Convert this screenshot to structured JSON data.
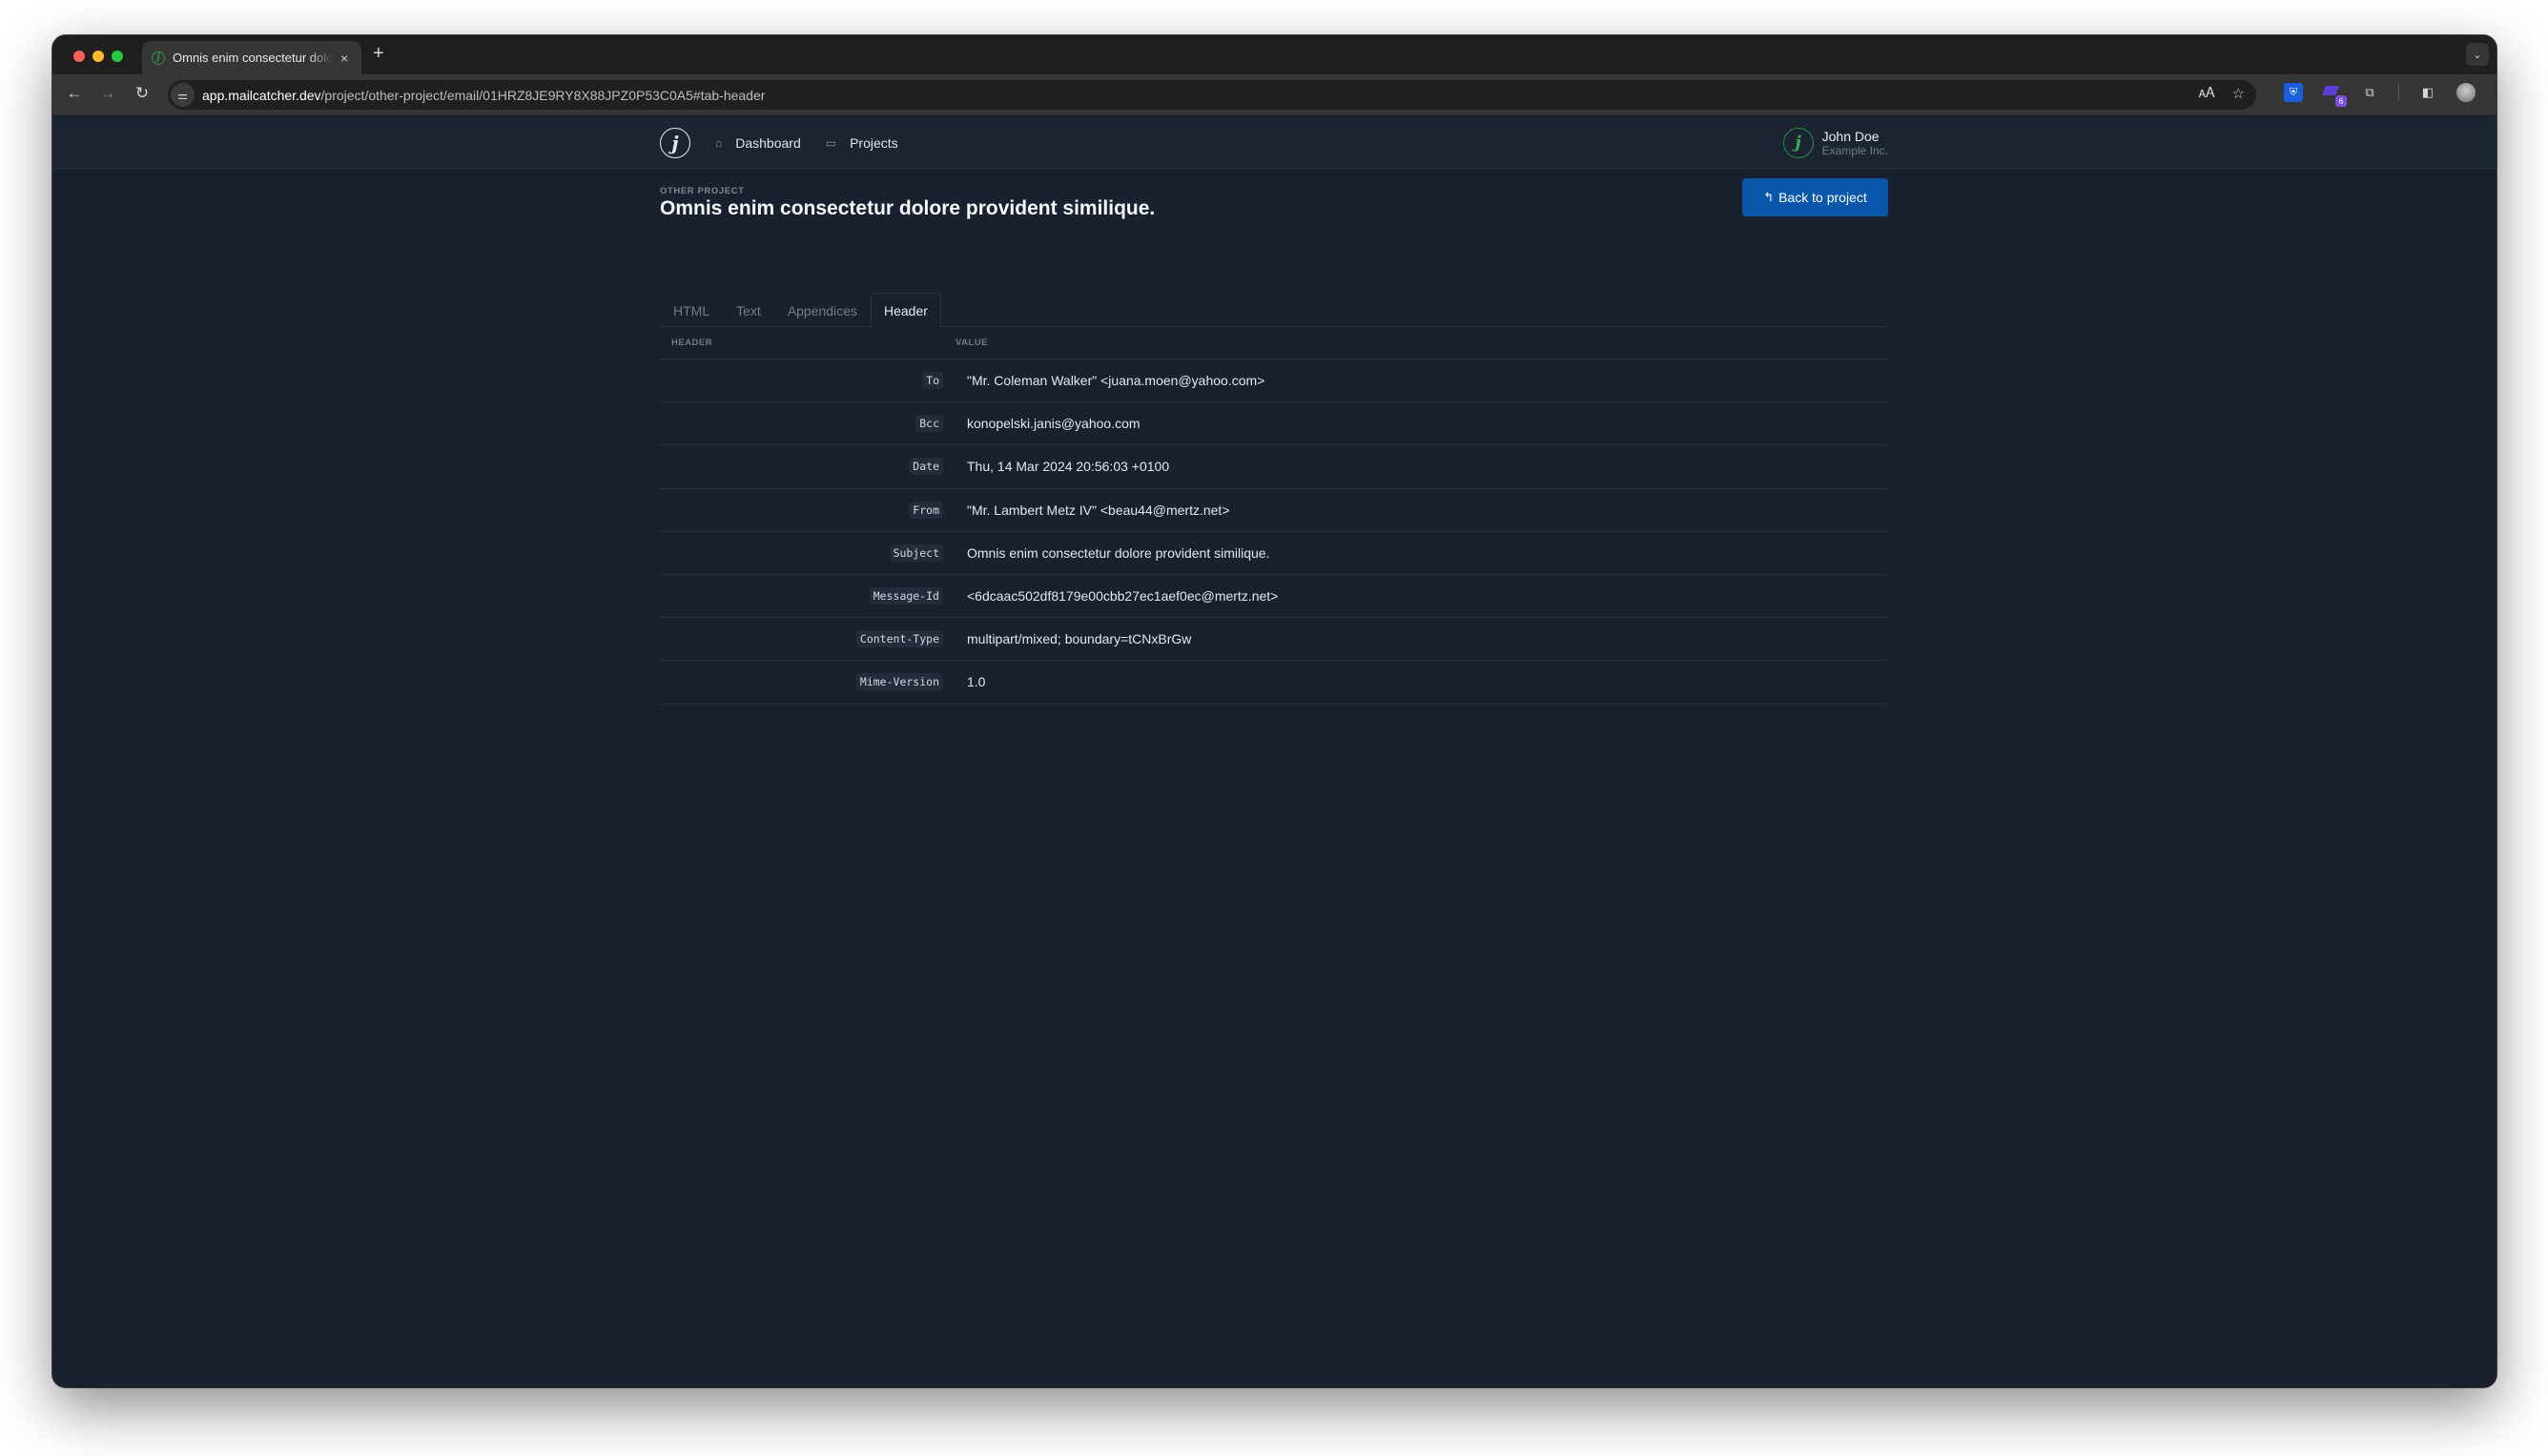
{
  "browser": {
    "tab_title": "Omnis enim consectetur dolore provident similique.",
    "tab_close": "×",
    "new_tab": "+",
    "tab_search": "⌄",
    "url_host": "app.mailcatcher.dev",
    "url_path": "/project/other-project/email/01HRZ8JE9RY8X88JPZ0P53C0A5#tab-header",
    "nav": {
      "back": "←",
      "forward": "→",
      "reload": "↻"
    },
    "site_info_icon": "⚌",
    "omnibox_icons": {
      "translate": "🗚",
      "bookmark": "☆"
    },
    "extensions": [
      {
        "name": "bitwarden",
        "glyph": "⛨"
      },
      {
        "name": "purple-extension",
        "badge": "6"
      },
      {
        "name": "extensions-puzzle",
        "glyph": "⧉"
      }
    ],
    "side_panel_icon": "◧",
    "menu_icon": "⋮"
  },
  "app": {
    "logo_glyph": "j",
    "nav": [
      {
        "label": "Dashboard",
        "icon": "⌂"
      },
      {
        "label": "Projects",
        "icon": "▭"
      }
    ],
    "user": {
      "name": "John Doe",
      "org": "Example Inc.",
      "avatar_glyph": "j"
    }
  },
  "page": {
    "eyebrow": "OTHER PROJECT",
    "title": "Omnis enim consectetur dolore provident similique.",
    "back_button": {
      "label": "Back to project",
      "icon": "↰"
    }
  },
  "tabs": [
    {
      "label": "HTML",
      "active": false
    },
    {
      "label": "Text",
      "active": false
    },
    {
      "label": "Appendices",
      "active": false
    },
    {
      "label": "Header",
      "active": true
    }
  ],
  "table": {
    "columns": [
      "HEADER",
      "VALUE"
    ],
    "rows": [
      {
        "key": "To",
        "value": "\"Mr. Coleman Walker\" <juana.moen@yahoo.com>"
      },
      {
        "key": "Bcc",
        "value": "konopelski.janis@yahoo.com"
      },
      {
        "key": "Date",
        "value": "Thu, 14 Mar 2024 20:56:03 +0100"
      },
      {
        "key": "From",
        "value": "\"Mr. Lambert Metz IV\" <beau44@mertz.net>"
      },
      {
        "key": "Subject",
        "value": "Omnis enim consectetur dolore provident similique."
      },
      {
        "key": "Message-Id",
        "value": "<6dcaac502df8179e00cbb27ec1aef0ec@mertz.net>"
      },
      {
        "key": "Content-Type",
        "value": "multipart/mixed; boundary=tCNxBrGw"
      },
      {
        "key": "Mime-Version",
        "value": "1.0"
      }
    ]
  },
  "colors": {
    "page_bg": "#18212d",
    "navbar_bg": "#1b2532",
    "primary_button": "#0957aa",
    "avatar_accent": "#3aa856"
  }
}
